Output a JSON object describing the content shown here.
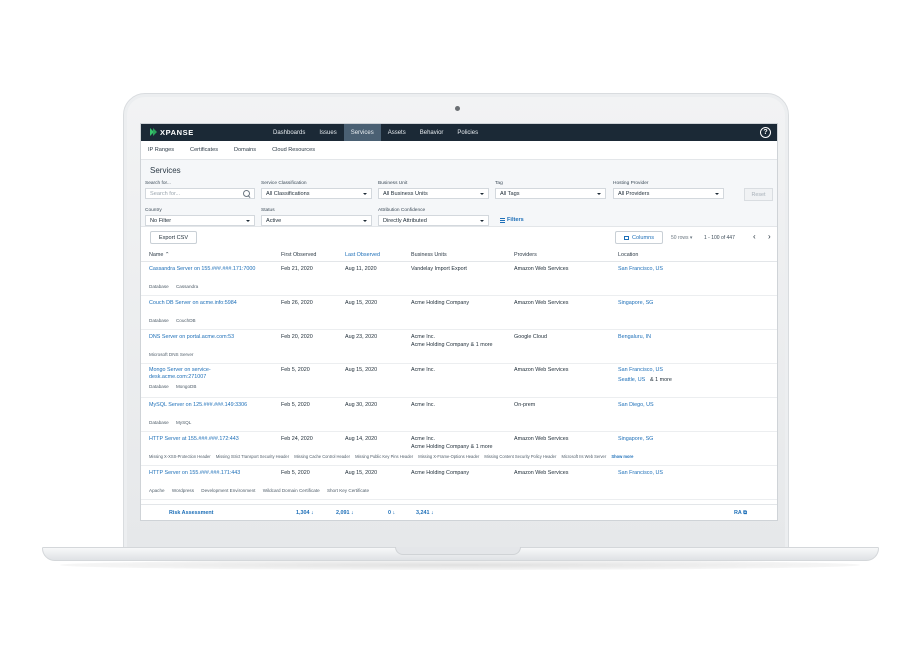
{
  "app": {
    "logo_text": "XPANSE"
  },
  "topnav": {
    "items": [
      {
        "label": "Dashboards"
      },
      {
        "label": "Issues"
      },
      {
        "label": "Services"
      },
      {
        "label": "Assets"
      },
      {
        "label": "Behavior"
      },
      {
        "label": "Policies"
      }
    ],
    "active": "Services",
    "help": "?"
  },
  "subnav": {
    "items": [
      "IP Ranges",
      "Certificates",
      "Domains",
      "Cloud Resources"
    ]
  },
  "page": {
    "title": "Services"
  },
  "filters": {
    "search": {
      "label": "Search for...",
      "placeholder": "Search for..."
    },
    "service_classification": {
      "label": "Service Classification",
      "value": "All Classifications"
    },
    "business_unit": {
      "label": "Business Unit",
      "value": "All Business Units"
    },
    "tag": {
      "label": "Tag",
      "value": "All Tags"
    },
    "hosting_provider": {
      "label": "Hosting Provider",
      "value": "All Providers"
    },
    "reset": "Reset",
    "country": {
      "label": "Country",
      "value": "No Filter"
    },
    "status": {
      "label": "Status",
      "value": "Active"
    },
    "attribution_confidence": {
      "label": "Attribution Confidence",
      "value": "Directly Attributed"
    },
    "filters_link": "Filters"
  },
  "toolbar": {
    "export_csv": "Export CSV",
    "columns": "Columns",
    "rows_per_page": "50 rows ▾",
    "pagination": "1 - 100 of 447"
  },
  "table": {
    "headers": {
      "name": "Name ⌃",
      "first_observed": "First Observed",
      "last_observed": "Last Observed",
      "business_units": "Business Units",
      "providers": "Providers",
      "location": "Location"
    },
    "rows": [
      {
        "name": "Cassandra Server on 155.###.###.171:7000",
        "first": "Feb 21, 2020",
        "last": "Aug 11, 2020",
        "bu": "Vandelay Import Export",
        "bu2": "",
        "provider": "Amazon Web Services",
        "location": "San Francisco, US",
        "location2": "",
        "tags": [
          "Database",
          "Cassandra"
        ]
      },
      {
        "name": "Couch DB Server on acme.info:5984",
        "first": "Feb 26, 2020",
        "last": "Aug 15, 2020",
        "bu": "Acme Holding Company",
        "bu2": "",
        "provider": "Amazon Web Services",
        "location": "Singapore, SG",
        "location2": "",
        "tags": [
          "Database",
          "CouchDB"
        ]
      },
      {
        "name": "DNS Server on portal.acme.com:53",
        "first": "Feb 20, 2020",
        "last": "Aug 23, 2020",
        "bu": "Acme Inc.",
        "bu2": "Acme Holding Company & 1 more",
        "provider": "Google Cloud",
        "location": "Bengaluru, IN",
        "location2": "",
        "tags": [
          "Microsoft DNS Server"
        ]
      },
      {
        "name": "Mongo Server on service-",
        "name2": "desk.acme.com:271007",
        "first": "Feb 5, 2020",
        "last": "Aug 15, 2020",
        "bu": "Acme Inc.",
        "bu2": "",
        "provider": "Amazon Web Services",
        "location": "San Francisco, US",
        "location2": "Seattle, US",
        "location_more": "& 1 more",
        "tags": [
          "Database",
          "MongoDB"
        ]
      },
      {
        "name": "MySQL Server on 125.###.###.149:3306",
        "first": "Feb 5, 2020",
        "last": "Aug 30, 2020",
        "bu": "Acme Inc.",
        "bu2": "",
        "provider": "On-prem",
        "location": "San Diego, US",
        "location2": "",
        "tags": [
          "Database",
          "MySQL"
        ]
      },
      {
        "name": "HTTP Server at 155.###.###.172:443",
        "first": "Feb 24, 2020",
        "last": "Aug 14, 2020",
        "bu": "Acme Inc.",
        "bu2": "Acme Holding Company & 1 more",
        "provider": "Amazon Web Services",
        "location": "Singapore, SG",
        "location2": "",
        "tags": [
          "Missing X-XSS-Protection Header",
          "Missing Strict Transport Security Header",
          "Missing Cache Control Header",
          "Missing Public Key Pins Header",
          "Missing X-Frame-Options Header",
          "Missing Content Security Policy Header",
          "Microsoft IIs Web Server"
        ],
        "tags_more": "Show more"
      },
      {
        "name": "HTTP Server on 155.###.###.171:443",
        "first": "Feb 5, 2020",
        "last": "Aug 15, 2020",
        "bu": "Acme Holding Company",
        "bu2": "",
        "provider": "Amazon Web Services",
        "location": "San Francisco, US",
        "location2": "",
        "tags": [
          "Apache",
          "Wordpress",
          "Development Environment",
          "Wildcard Domain Certificate",
          "Short Key Certificate"
        ]
      }
    ]
  },
  "summary": {
    "label": "Risk Assessment",
    "v1": "1,304 ↓",
    "v2": "2,091 ↓",
    "v3": "0 ↓",
    "v4": "3,241 ↓",
    "ra": "RA ⧉"
  }
}
